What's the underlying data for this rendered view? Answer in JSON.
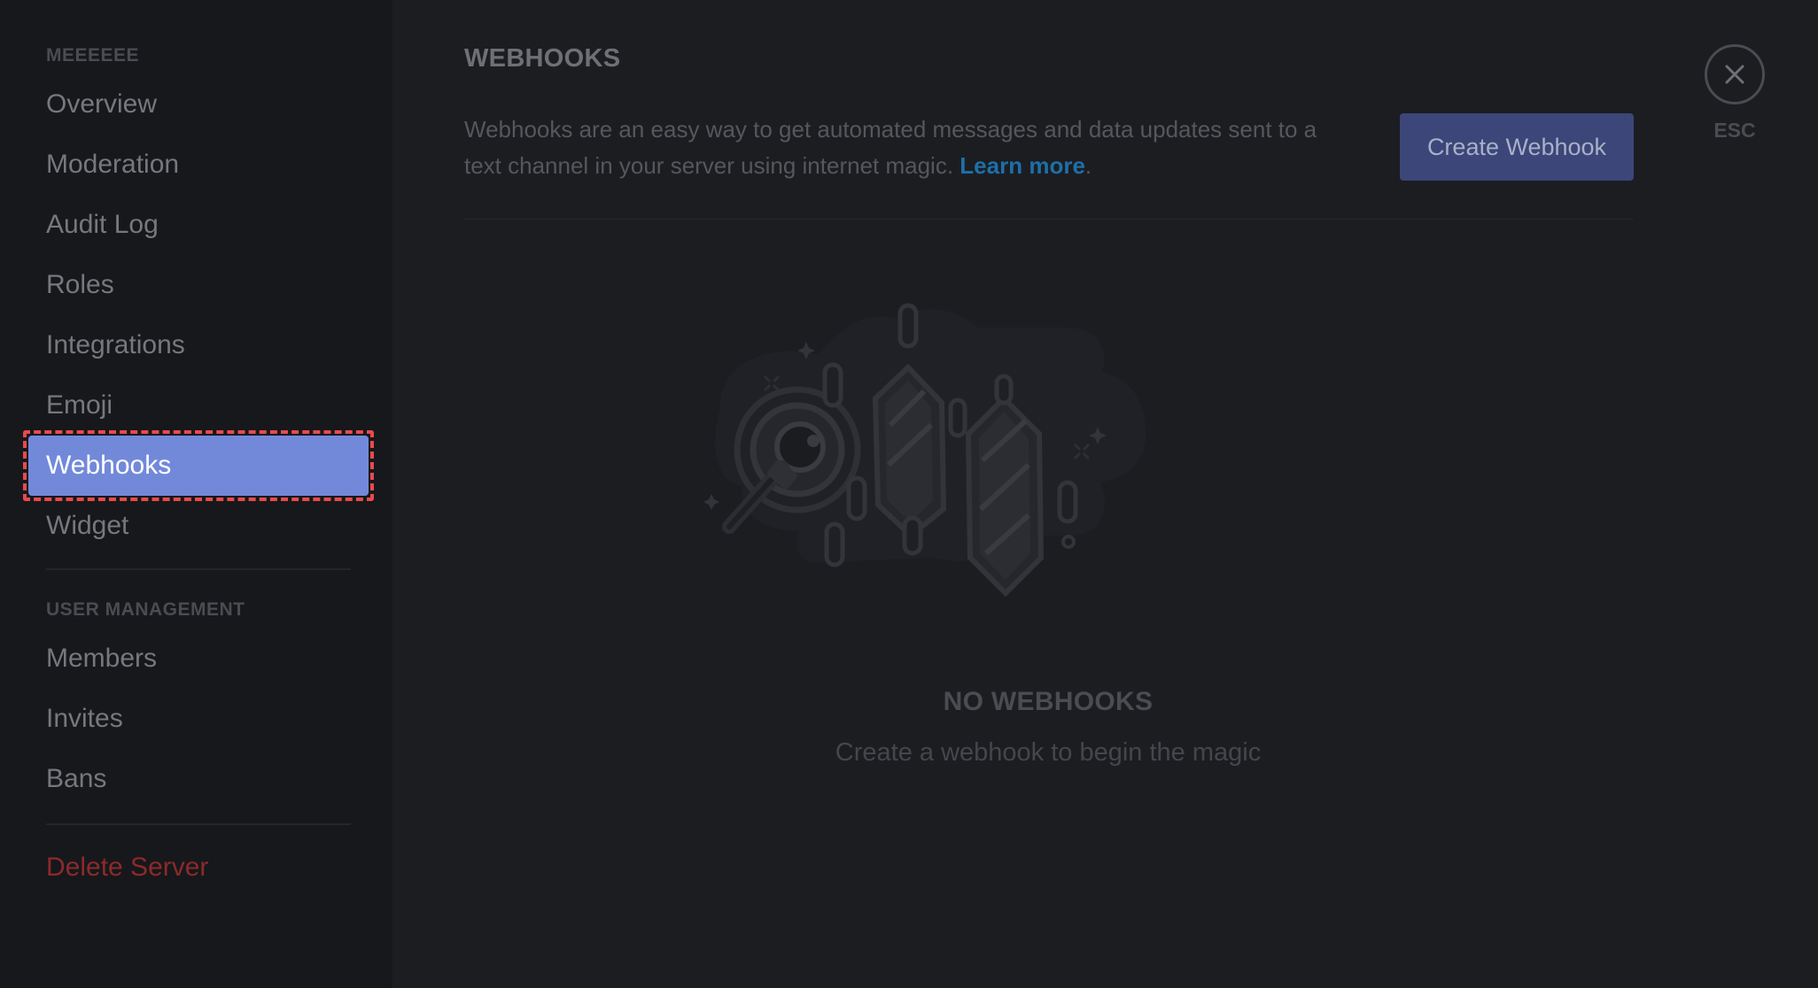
{
  "sidebar": {
    "server_header": "MEEEEEE",
    "server_items": [
      {
        "label": "Overview"
      },
      {
        "label": "Moderation"
      },
      {
        "label": "Audit Log"
      },
      {
        "label": "Roles"
      },
      {
        "label": "Integrations"
      },
      {
        "label": "Emoji"
      },
      {
        "label": "Webhooks",
        "selected": true
      },
      {
        "label": "Widget"
      }
    ],
    "user_header": "USER MANAGEMENT",
    "user_items": [
      {
        "label": "Members"
      },
      {
        "label": "Invites"
      },
      {
        "label": "Bans"
      }
    ],
    "delete_label": "Delete Server"
  },
  "main": {
    "title": "WEBHOOKS",
    "description": "Webhooks are an easy way to get automated messages and data updates sent to a text channel in your server using internet magic.",
    "learn_more": "Learn more",
    "description_suffix": ".",
    "create_button": "Create Webhook",
    "esc_label": "ESC",
    "empty_title": "NO WEBHOOKS",
    "empty_subtitle": "Create a webhook to begin the magic"
  },
  "colors": {
    "accent": "#7289da",
    "button": "#3c4679",
    "link": "#1e6fa8",
    "danger": "#8a2a2c",
    "highlight_outline": "#e84a4f"
  },
  "icons": {
    "close": "close-icon",
    "empty_state": "webhook-empty-illustration"
  }
}
